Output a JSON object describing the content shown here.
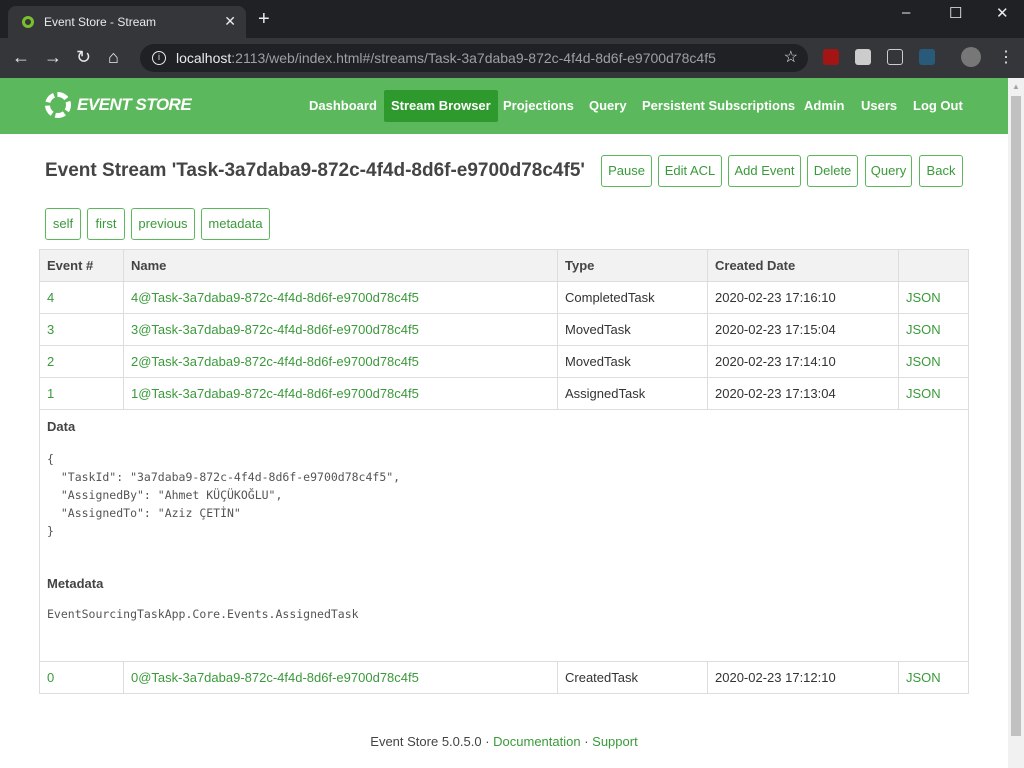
{
  "browser": {
    "tab_title": "Event Store - Stream",
    "url_host": "localhost",
    "url_rest": ":2113/web/index.html#/streams/Task-3a7daba9-872c-4f4d-8d6f-e9700d78c4f5"
  },
  "nav": {
    "logo": "EVENT STORE",
    "items": [
      "Dashboard",
      "Stream Browser",
      "Projections",
      "Query",
      "Persistent Subscriptions",
      "Admin",
      "Users",
      "Log Out"
    ],
    "active": "Stream Browser"
  },
  "page": {
    "title": "Event Stream 'Task-3a7daba9-872c-4f4d-8d6f-e9700d78c4f5'",
    "actions": [
      "Pause",
      "Edit ACL",
      "Add Event",
      "Delete",
      "Query",
      "Back"
    ],
    "links": [
      "self",
      "first",
      "previous",
      "metadata"
    ]
  },
  "table": {
    "headers": [
      "Event #",
      "Name",
      "Type",
      "Created Date",
      ""
    ],
    "rows": [
      {
        "num": "4",
        "name": "4@Task-3a7daba9-872c-4f4d-8d6f-e9700d78c4f5",
        "type": "CompletedTask",
        "date": "2020-02-23 17:16:10",
        "json": "JSON"
      },
      {
        "num": "3",
        "name": "3@Task-3a7daba9-872c-4f4d-8d6f-e9700d78c4f5",
        "type": "MovedTask",
        "date": "2020-02-23 17:15:04",
        "json": "JSON"
      },
      {
        "num": "2",
        "name": "2@Task-3a7daba9-872c-4f4d-8d6f-e9700d78c4f5",
        "type": "MovedTask",
        "date": "2020-02-23 17:14:10",
        "json": "JSON"
      },
      {
        "num": "1",
        "name": "1@Task-3a7daba9-872c-4f4d-8d6f-e9700d78c4f5",
        "type": "AssignedTask",
        "date": "2020-02-23 17:13:04",
        "json": "JSON"
      },
      {
        "num": "0",
        "name": "0@Task-3a7daba9-872c-4f4d-8d6f-e9700d78c4f5",
        "type": "CreatedTask",
        "date": "2020-02-23 17:12:10",
        "json": "JSON"
      }
    ],
    "detail": {
      "data_label": "Data",
      "data": "{\n  \"TaskId\": \"3a7daba9-872c-4f4d-8d6f-e9700d78c4f5\",\n  \"AssignedBy\": \"Ahmet KÜÇÜKOĞLU\",\n  \"AssignedTo\": \"Aziz ÇETİN\"\n}",
      "metadata_label": "Metadata",
      "metadata": "EventSourcingTaskApp.Core.Events.AssignedTask"
    }
  },
  "footer": {
    "version": "Event Store 5.0.5.0",
    "sep": " · ",
    "documentation": "Documentation",
    "support": "Support"
  },
  "colors": {
    "brand": "#5cb85c",
    "active": "#2e9a2e",
    "link": "#3a9a3a"
  }
}
